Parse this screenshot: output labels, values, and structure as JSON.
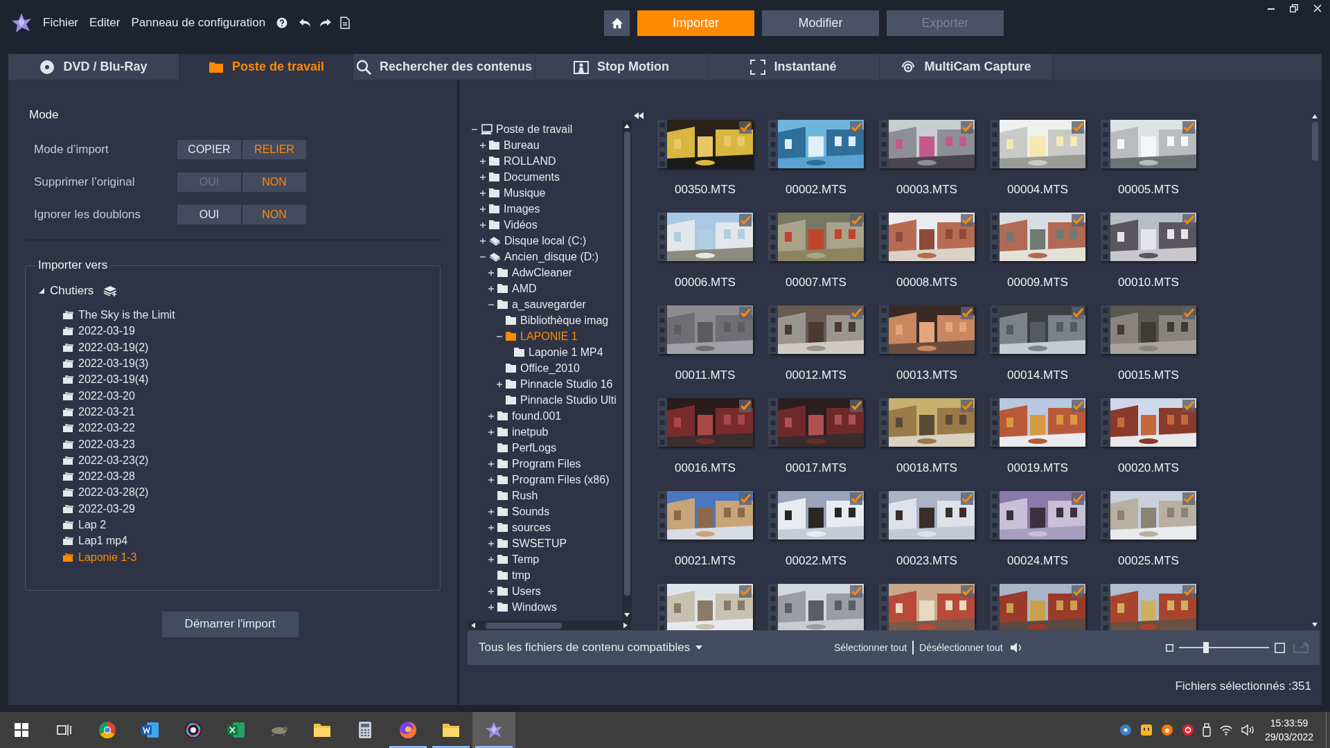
{
  "menu": [
    "Fichier",
    "Editer",
    "Panneau de configuration"
  ],
  "modes": [
    {
      "label": "Importer",
      "selected": true,
      "disabled": false
    },
    {
      "label": "Modifier",
      "selected": false,
      "disabled": false
    },
    {
      "label": "Exporter",
      "selected": false,
      "disabled": true
    }
  ],
  "tabs": [
    {
      "label": "DVD / Blu-Ray",
      "selected": false
    },
    {
      "label": "Poste de travail",
      "selected": true
    },
    {
      "label": "Rechercher des contenus",
      "selected": false
    },
    {
      "label": "Stop Motion",
      "selected": false
    },
    {
      "label": "Instantané",
      "selected": false
    },
    {
      "label": "MultiCam Capture",
      "selected": false
    }
  ],
  "mode_panel": {
    "title": "Mode",
    "settings": [
      {
        "label": "Mode d’import",
        "options": [
          {
            "label": "COPIER",
            "selected": false,
            "disabled": false
          },
          {
            "label": "RELIER",
            "selected": true,
            "disabled": false
          }
        ]
      },
      {
        "label": "Supprimer l’original",
        "options": [
          {
            "label": "OUI",
            "selected": false,
            "disabled": true
          },
          {
            "label": "NON",
            "selected": true,
            "disabled": false
          }
        ]
      },
      {
        "label": "Ignorer les doublons",
        "options": [
          {
            "label": "OUI",
            "selected": false,
            "disabled": false
          },
          {
            "label": "NON",
            "selected": true,
            "disabled": false
          }
        ]
      }
    ]
  },
  "import_to": {
    "title": "Importer vers",
    "root": {
      "label": "Chutiers",
      "expanded": true
    },
    "bins": [
      {
        "label": "The Sky is the Limit",
        "selected": false
      },
      {
        "label": "2022-03-19",
        "selected": false
      },
      {
        "label": "2022-03-19(2)",
        "selected": false
      },
      {
        "label": "2022-03-19(3)",
        "selected": false
      },
      {
        "label": "2022-03-19(4)",
        "selected": false
      },
      {
        "label": "2022-03-20",
        "selected": false
      },
      {
        "label": "2022-03-21",
        "selected": false
      },
      {
        "label": "2022-03-22",
        "selected": false
      },
      {
        "label": "2022-03-23",
        "selected": false
      },
      {
        "label": "2022-03-23(2)",
        "selected": false
      },
      {
        "label": "2022-03-28",
        "selected": false
      },
      {
        "label": "2022-03-28(2)",
        "selected": false
      },
      {
        "label": "2022-03-29",
        "selected": false
      },
      {
        "label": "Lap 2",
        "selected": false
      },
      {
        "label": "Lap1 mp4",
        "selected": false
      },
      {
        "label": "Laponie 1-3",
        "selected": true
      }
    ],
    "start_button": "Démarrer l'import"
  },
  "tree": [
    {
      "label": "Poste de travail",
      "kind": "computer",
      "expanded": true,
      "selected": false,
      "children": [
        {
          "label": "Bureau",
          "kind": "folder",
          "expanded": false,
          "selected": false
        },
        {
          "label": "ROLLAND",
          "kind": "folder",
          "expanded": false,
          "selected": false
        },
        {
          "label": "Documents",
          "kind": "folder",
          "expanded": false,
          "selected": false
        },
        {
          "label": "Musique",
          "kind": "folder",
          "expanded": false,
          "selected": false
        },
        {
          "label": "Images",
          "kind": "folder",
          "expanded": false,
          "selected": false
        },
        {
          "label": "Vidéos",
          "kind": "folder",
          "expanded": false,
          "selected": false
        },
        {
          "label": "Disque local (C:)",
          "kind": "drive",
          "expanded": false,
          "selected": false
        },
        {
          "label": "Ancien_disque (D:)",
          "kind": "drive",
          "expanded": true,
          "selected": false,
          "children": [
            {
              "label": "AdwCleaner",
              "kind": "folder",
              "expanded": false,
              "selected": false
            },
            {
              "label": "AMD",
              "kind": "folder",
              "expanded": false,
              "selected": false
            },
            {
              "label": "a_sauvegarder",
              "kind": "folder",
              "expanded": true,
              "selected": false,
              "children": [
                {
                  "label": "Bibliothèque imag",
                  "kind": "folder",
                  "selected": false
                },
                {
                  "label": "LAPONIE 1",
                  "kind": "folder",
                  "expanded": true,
                  "selected": true,
                  "children": [
                    {
                      "label": "Laponie 1 MP4",
                      "kind": "folder",
                      "selected": false
                    }
                  ]
                },
                {
                  "label": "Office_2010",
                  "kind": "folder",
                  "selected": false
                },
                {
                  "label": "Pinnacle Studio 16",
                  "kind": "folder",
                  "expanded": false,
                  "selected": false
                },
                {
                  "label": "Pinnacle Studio Ulti",
                  "kind": "folder",
                  "selected": false
                }
              ]
            },
            {
              "label": "found.001",
              "kind": "folder",
              "expanded": false,
              "selected": false
            },
            {
              "label": "inetpub",
              "kind": "folder",
              "expanded": false,
              "selected": false
            },
            {
              "label": "PerfLogs",
              "kind": "folder",
              "selected": false
            },
            {
              "label": "Program Files",
              "kind": "folder",
              "expanded": false,
              "selected": false
            },
            {
              "label": "Program Files (x86)",
              "kind": "folder",
              "expanded": false,
              "selected": false
            },
            {
              "label": "Rush",
              "kind": "folder",
              "selected": false
            },
            {
              "label": "Sounds",
              "kind": "folder",
              "expanded": false,
              "selected": false
            },
            {
              "label": "sources",
              "kind": "folder",
              "expanded": false,
              "selected": false
            },
            {
              "label": "SWSETUP",
              "kind": "folder",
              "expanded": false,
              "selected": false
            },
            {
              "label": "Temp",
              "kind": "folder",
              "expanded": false,
              "selected": false
            },
            {
              "label": "tmp",
              "kind": "folder",
              "selected": false
            },
            {
              "label": "Users",
              "kind": "folder",
              "expanded": false,
              "selected": false
            },
            {
              "label": "Windows",
              "kind": "folder",
              "expanded": false,
              "selected": false
            }
          ]
        }
      ]
    }
  ],
  "thumbnails": [
    {
      "name": "00350.MTS",
      "checked": true
    },
    {
      "name": "00002.MTS",
      "checked": true
    },
    {
      "name": "00003.MTS",
      "checked": true
    },
    {
      "name": "00004.MTS",
      "checked": true
    },
    {
      "name": "00005.MTS",
      "checked": true
    },
    {
      "name": "00006.MTS",
      "checked": true
    },
    {
      "name": "00007.MTS",
      "checked": true
    },
    {
      "name": "00008.MTS",
      "checked": true
    },
    {
      "name": "00009.MTS",
      "checked": true
    },
    {
      "name": "00010.MTS",
      "checked": true
    },
    {
      "name": "00011.MTS",
      "checked": true
    },
    {
      "name": "00012.MTS",
      "checked": true
    },
    {
      "name": "00013.MTS",
      "checked": true
    },
    {
      "name": "00014.MTS",
      "checked": true
    },
    {
      "name": "00015.MTS",
      "checked": true
    },
    {
      "name": "00016.MTS",
      "checked": true
    },
    {
      "name": "00017.MTS",
      "checked": true
    },
    {
      "name": "00018.MTS",
      "checked": true
    },
    {
      "name": "00019.MTS",
      "checked": true
    },
    {
      "name": "00020.MTS",
      "checked": true
    },
    {
      "name": "00021.MTS",
      "checked": true
    },
    {
      "name": "00022.MTS",
      "checked": true
    },
    {
      "name": "00023.MTS",
      "checked": true
    },
    {
      "name": "00024.MTS",
      "checked": true
    },
    {
      "name": "00025.MTS",
      "checked": true
    },
    {
      "checked": true
    },
    {
      "checked": true
    },
    {
      "checked": true
    },
    {
      "checked": true
    },
    {
      "checked": true
    }
  ],
  "bottom_bar": {
    "filter": "Tous les fichiers de contenu compatibles",
    "select_all": "Sélectionner tout",
    "deselect_all": "Désélectionner tout",
    "zoom": {
      "level": 0.3
    }
  },
  "status": "Fichiers sélectionnés :351",
  "taskbar": {
    "apps": [
      {
        "kind": "start",
        "open": false,
        "selected": false
      },
      {
        "kind": "taskview",
        "open": false,
        "selected": false
      },
      {
        "kind": "browser",
        "open": false,
        "selected": false
      },
      {
        "kind": "word",
        "open": false,
        "selected": false
      },
      {
        "kind": "ring",
        "open": false,
        "selected": false
      },
      {
        "kind": "sheet",
        "open": false,
        "selected": false
      },
      {
        "kind": "tool",
        "open": false,
        "selected": false
      },
      {
        "kind": "folder",
        "open": false,
        "selected": false
      },
      {
        "kind": "calc",
        "open": false,
        "selected": false
      },
      {
        "kind": "fox",
        "open": true,
        "selected": false
      },
      {
        "kind": "folder",
        "open": true,
        "selected": false
      },
      {
        "kind": "star",
        "open": true,
        "selected": true
      }
    ],
    "time": "15:33:59",
    "date": "29/03/2022"
  }
}
